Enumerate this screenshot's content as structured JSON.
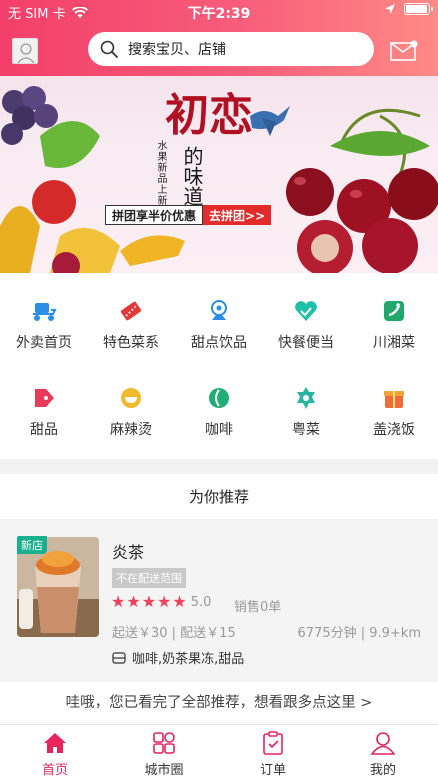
{
  "status": {
    "carrier": "无 SIM 卡",
    "time": "下午2:39",
    "battery_level": 0.9
  },
  "search": {
    "placeholder": "搜索宝贝、店铺",
    "icon": "search-icon"
  },
  "header": {
    "avatar_icon": "avatar",
    "message_icon": "mail-icon"
  },
  "banner": {
    "title": "初恋的味道",
    "title_big": "初恋",
    "title_sub": "的味道",
    "tag": "水果新品上新季",
    "pitch": "拼团享半价优惠",
    "cta": "去拼团>>"
  },
  "categories": [
    {
      "label": "外卖首页",
      "icon": "scooter-icon",
      "color": "#2a8ee6"
    },
    {
      "label": "特色菜系",
      "icon": "ticket-icon",
      "color": "#e23a3a"
    },
    {
      "label": "甜点饮品",
      "icon": "ice-cream-icon",
      "color": "#2a8ee6"
    },
    {
      "label": "快餐便当",
      "icon": "heart-check-icon",
      "color": "#20c0a8"
    },
    {
      "label": "川湘菜",
      "icon": "chili-icon",
      "color": "#1fa86a"
    },
    {
      "label": "甜品",
      "icon": "tag-icon",
      "color": "#e83a5a"
    },
    {
      "label": "麻辣烫",
      "icon": "bowl-icon",
      "color": "#f3b92c"
    },
    {
      "label": "咖啡",
      "icon": "coffee-icon",
      "color": "#1fae76"
    },
    {
      "label": "粤菜",
      "icon": "dish-icon",
      "color": "#2bb3a3"
    },
    {
      "label": "盖浇饭",
      "icon": "gift-icon",
      "color": "#ef6b3a"
    }
  ],
  "recommend": {
    "title": "为你推荐",
    "shop": {
      "badge": "新店",
      "name": "炎茶",
      "scope": "不在配送范围",
      "rating": 5,
      "score": "5.0",
      "sales": "销售0单",
      "fee": "起送￥30 | 配送￥15",
      "distance": "6775分钟 | 9.9+km",
      "tags": "咖啡,奶茶果冻,甜品"
    },
    "more": "哇哦，您已看完了全部推荐，想看跟多点这里 >"
  },
  "tabs": [
    {
      "label": "首页",
      "icon": "home-icon",
      "active": true
    },
    {
      "label": "城市圈",
      "icon": "grid-icon",
      "active": false
    },
    {
      "label": "订单",
      "icon": "order-icon",
      "active": false
    },
    {
      "label": "我的",
      "icon": "user-icon",
      "active": false
    }
  ],
  "colors": {
    "brand": "#f33f6a",
    "active": "#e8245c",
    "star": "#f2405b",
    "badge": "#19b08e"
  }
}
